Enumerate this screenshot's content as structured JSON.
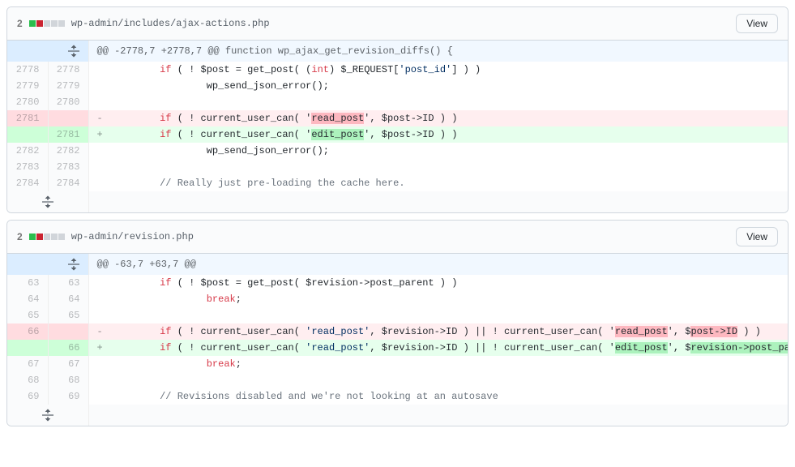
{
  "files": [
    {
      "count": "2",
      "path": "wp-admin/includes/ajax-actions.php",
      "view": "View",
      "lines": [
        {
          "type": "hunk",
          "oldNum": "",
          "newNum": "",
          "text": "@@ -2778,7 +2778,7 @@ function wp_ajax_get_revision_diffs() {"
        },
        {
          "type": "ctx",
          "oldNum": "2778",
          "newNum": "2778",
          "text": "        if ( ! $post = get_post( (int) $_REQUEST['post_id'] ) )"
        },
        {
          "type": "ctx",
          "oldNum": "2779",
          "newNum": "2779",
          "text": "                wp_send_json_error();"
        },
        {
          "type": "ctx",
          "oldNum": "2780",
          "newNum": "2780",
          "text": ""
        },
        {
          "type": "del",
          "oldNum": "2781",
          "newNum": "",
          "text": "        if ( ! current_user_can( '",
          "hl": "read_post",
          "textAfter": "', $post->ID ) )"
        },
        {
          "type": "add",
          "oldNum": "",
          "newNum": "2781",
          "text": "        if ( ! current_user_can( '",
          "hl": "edit_post",
          "textAfter": "', $post->ID ) )"
        },
        {
          "type": "ctx",
          "oldNum": "2782",
          "newNum": "2782",
          "text": "                wp_send_json_error();"
        },
        {
          "type": "ctx",
          "oldNum": "2783",
          "newNum": "2783",
          "text": ""
        },
        {
          "type": "ctx",
          "oldNum": "2784",
          "newNum": "2784",
          "text": "        // Really just pre-loading the cache here."
        }
      ]
    },
    {
      "count": "2",
      "path": "wp-admin/revision.php",
      "view": "View",
      "lines": [
        {
          "type": "hunk",
          "oldNum": "",
          "newNum": "",
          "text": "@@ -63,7 +63,7 @@"
        },
        {
          "type": "ctx",
          "oldNum": "63",
          "newNum": "63",
          "text": "        if ( ! $post = get_post( $revision->post_parent ) )"
        },
        {
          "type": "ctx",
          "oldNum": "64",
          "newNum": "64",
          "text": "                break;"
        },
        {
          "type": "ctx",
          "oldNum": "65",
          "newNum": "65",
          "text": ""
        },
        {
          "type": "del",
          "oldNum": "66",
          "newNum": "",
          "text": "        if ( ! current_user_can( 'read_post', $revision->ID ) || ! current_user_can( '",
          "hl": "read_post",
          "textAfter": "', $",
          "hl2": "post->ID",
          "textAfter2": " ) )"
        },
        {
          "type": "add",
          "oldNum": "",
          "newNum": "66",
          "text": "        if ( ! current_user_can( 'read_post', $revision->ID ) || ! current_user_can( '",
          "hl": "edit_post",
          "textAfter": "', $",
          "hl2": "revision->post_parent",
          "textAfter2": " ) )"
        },
        {
          "type": "ctx",
          "oldNum": "67",
          "newNum": "67",
          "text": "                break;"
        },
        {
          "type": "ctx",
          "oldNum": "68",
          "newNum": "68",
          "text": ""
        },
        {
          "type": "ctx",
          "oldNum": "69",
          "newNum": "69",
          "text": "        // Revisions disabled and we're not looking at an autosave"
        }
      ]
    }
  ]
}
